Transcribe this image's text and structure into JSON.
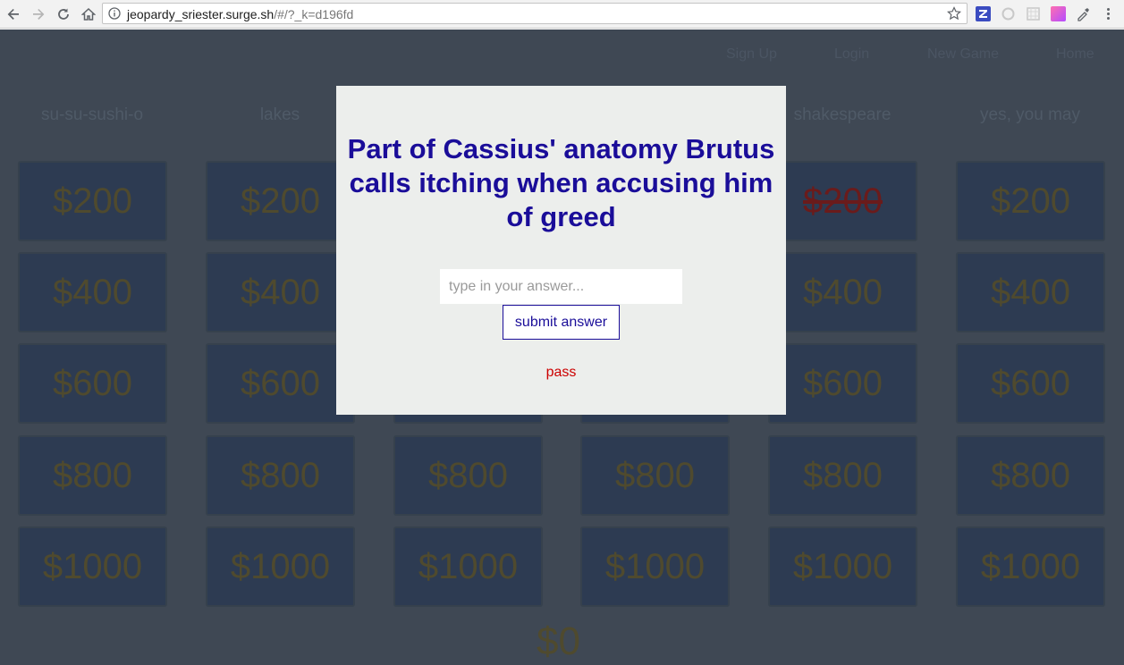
{
  "browser": {
    "url_host": "jeopardy_sriester.surge.sh",
    "url_path": "/#/?_k=d196fd"
  },
  "nav": {
    "sign_up": "Sign Up",
    "login": "Login",
    "new_game": "New Game",
    "home": "Home"
  },
  "categories": [
    "su-su-sushi-o",
    "lakes",
    "",
    "",
    "shakespeare",
    "yes, you may"
  ],
  "values": [
    "$200",
    "$400",
    "$600",
    "$800",
    "$1000"
  ],
  "used_tiles": [
    {
      "category": 4,
      "value": "$200"
    }
  ],
  "score": "$0",
  "modal": {
    "question": "Part of Cassius' anatomy Brutus calls itching when accusing him of greed",
    "input_placeholder": "type in your answer...",
    "submit_label": "submit answer",
    "pass_label": "pass"
  },
  "colors": {
    "board_bg": "#3f4854",
    "tile_bg": "#2d3b52",
    "question_text": "#1a0d99",
    "pass_text": "#cc0000"
  }
}
